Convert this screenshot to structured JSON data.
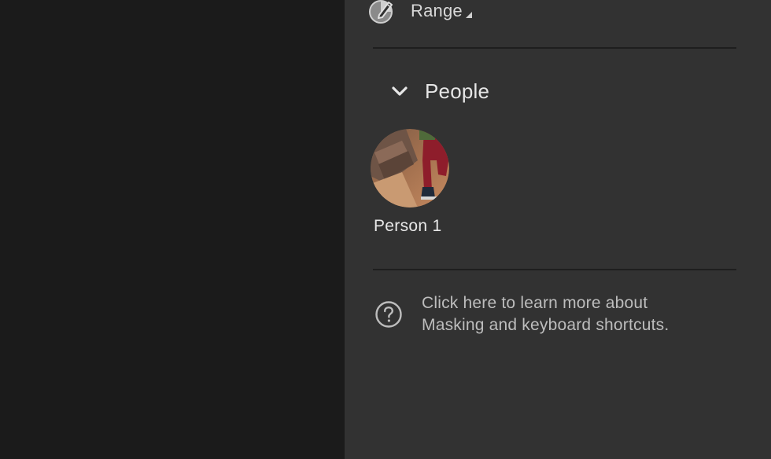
{
  "range": {
    "label": "Range",
    "icon": "range-mask-icon",
    "caret_icon": "dropdown-caret-icon"
  },
  "people_section": {
    "title": "People",
    "chevron_icon": "chevron-down-icon",
    "people": [
      {
        "label": "Person 1",
        "thumbnail": "person-thumbnail"
      }
    ]
  },
  "help": {
    "icon": "question-circle-icon",
    "line1": "Click here to learn more about",
    "line2": "Masking and keyboard shortcuts."
  },
  "colors": {
    "canvas_bg": "#1b1b1b",
    "panel_bg": "#323232",
    "divider": "#1e1e1e",
    "text_primary": "#e6e6e6",
    "text_secondary": "#bdbdbd"
  }
}
